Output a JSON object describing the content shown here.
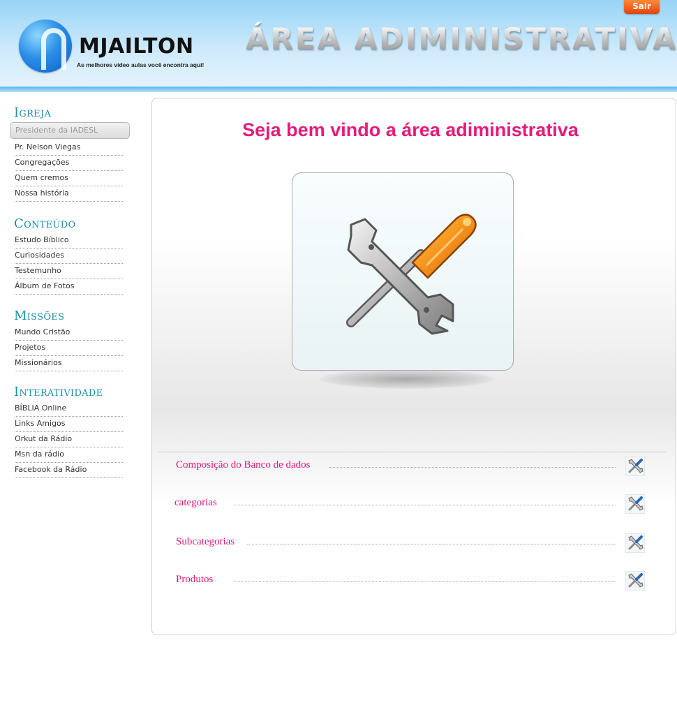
{
  "header": {
    "logo_name": "MJAILTON",
    "logo_tagline": "As melhores vídeo aulas você encontra aqui!",
    "title": "ÁREA ADIMINISTRATIVA",
    "logout_label": "Sair"
  },
  "sidebar": {
    "sections": [
      {
        "title": "Igreja",
        "items": [
          "Presidente da IADESL",
          "Pr. Nelson Viegas",
          "Congregações",
          "Quem cremos",
          "Nossa história"
        ]
      },
      {
        "title": "Conteúdo",
        "items": [
          "Estudo Bíblico",
          "Curiosidades",
          "Testemunho",
          "Álbum de Fotos"
        ]
      },
      {
        "title": "Missões",
        "items": [
          "Mundo Cristão",
          "Projetos",
          "Missionários"
        ]
      },
      {
        "title": "Interatividade",
        "items": [
          "BÍBLIA Online",
          "Links Amigos",
          "Orkut da Rádio",
          "Msn da rádio",
          "Facebook da Rádio"
        ]
      }
    ],
    "active_item": "Presidente da IADESL"
  },
  "main": {
    "welcome": "Seja bem vindo a área adiministrativa",
    "links": [
      "Composição do Banco de dados",
      "categorias",
      "Subcategorias",
      "Produtos"
    ]
  },
  "colors": {
    "accent_pink": "#e8197a",
    "section_teal": "#1a8fa8",
    "logout_orange": "#e4410a",
    "header_blue": "#98d4f7"
  },
  "icons": {
    "tools": "wrench-screwdriver-icon",
    "row_tools": "tools-small-icon"
  }
}
